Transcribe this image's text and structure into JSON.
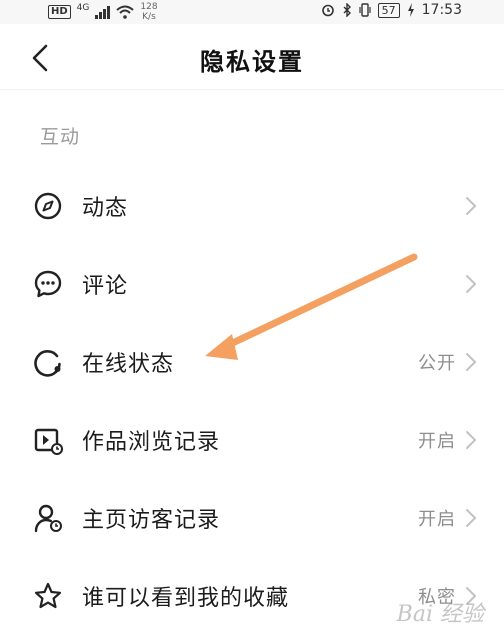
{
  "status_bar": {
    "hd": "HD",
    "network_type": "4G",
    "speed_value": "128",
    "speed_unit": "K/s",
    "battery": "57",
    "time": "17:53"
  },
  "header": {
    "title": "隐私设置"
  },
  "section": {
    "title": "互动"
  },
  "rows": [
    {
      "label": "动态",
      "value": "",
      "icon": "compass-icon"
    },
    {
      "label": "评论",
      "value": "",
      "icon": "comment-icon"
    },
    {
      "label": "在线状态",
      "value": "公开",
      "icon": "online-status-icon"
    },
    {
      "label": "作品浏览记录",
      "value": "开启",
      "icon": "video-history-icon"
    },
    {
      "label": "主页访客记录",
      "value": "开启",
      "icon": "visitor-history-icon"
    },
    {
      "label": "谁可以看到我的收藏",
      "value": "私密",
      "icon": "star-icon"
    }
  ],
  "annotation": {
    "arrow_color": "#f4a060"
  },
  "watermark": "Bai 经验"
}
